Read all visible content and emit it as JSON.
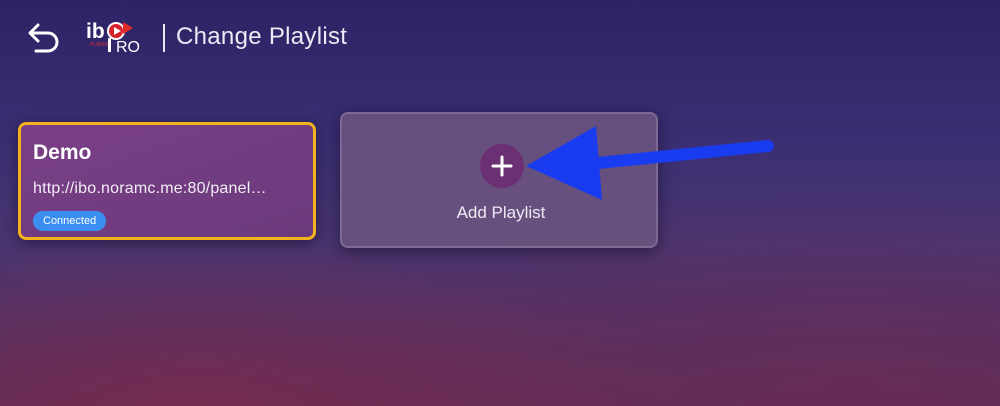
{
  "header": {
    "title": "Change Playlist",
    "logo_text": "iboPRO",
    "back_icon": "back-arrow-icon"
  },
  "playlists": [
    {
      "name": "Demo",
      "url": "http://ibo.noramc.me:80/panel…",
      "status": "Connected",
      "selected": true
    }
  ],
  "add_card": {
    "label": "Add Playlist",
    "icon": "plus-icon"
  },
  "colors": {
    "selection_border": "#f2b21c",
    "status_badge": "#3a8ef0",
    "annotation_arrow": "#1a3cf0",
    "card_background": "#7a3f86"
  }
}
